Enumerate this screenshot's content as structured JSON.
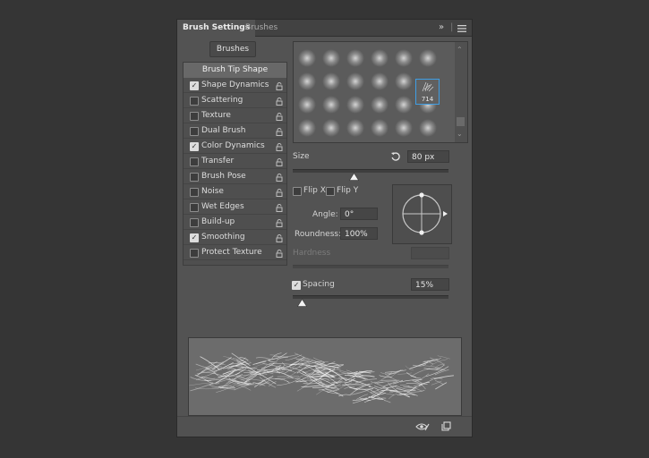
{
  "tabs": {
    "brush_settings": "Brush Settings",
    "brushes": "Brushes",
    "expand_icon": "double-chevron-right-icon",
    "menu_icon": "menu-icon"
  },
  "brushes_button": "Brushes",
  "options_header": "Brush Tip Shape",
  "options": [
    {
      "label": "Shape Dynamics",
      "checked": true
    },
    {
      "label": "Scattering",
      "checked": false
    },
    {
      "label": "Texture",
      "checked": false
    },
    {
      "label": "Dual Brush",
      "checked": false
    },
    {
      "label": "Color Dynamics",
      "checked": true
    },
    {
      "label": "Transfer",
      "checked": false
    },
    {
      "label": "Brush Pose",
      "checked": false
    },
    {
      "label": "Noise",
      "checked": false
    },
    {
      "label": "Wet Edges",
      "checked": false
    },
    {
      "label": "Build-up",
      "checked": false
    },
    {
      "label": "Smoothing",
      "checked": true
    },
    {
      "label": "Protect Texture",
      "checked": false
    }
  ],
  "tip_preview": {
    "selected_count": "714"
  },
  "size": {
    "label": "Size",
    "value": "80 px",
    "slider_level": 0.39
  },
  "flip_x": {
    "label": "Flip X",
    "checked": false
  },
  "flip_y": {
    "label": "Flip Y",
    "checked": false
  },
  "angle": {
    "label": "Angle:",
    "value": "0°"
  },
  "roundness": {
    "label": "Roundness:",
    "value": "100%"
  },
  "hardness": {
    "label": "Hardness",
    "value": ""
  },
  "spacing": {
    "label": "Spacing",
    "checked": true,
    "value": "15%",
    "slider_level": 0.06
  },
  "bottom_icons": {
    "visibility": "eye-toggle-icon",
    "new_preset": "new-preset-icon"
  },
  "colors": {
    "panel": "#535353",
    "selection": "#3f9ee4",
    "background": "#353535"
  }
}
